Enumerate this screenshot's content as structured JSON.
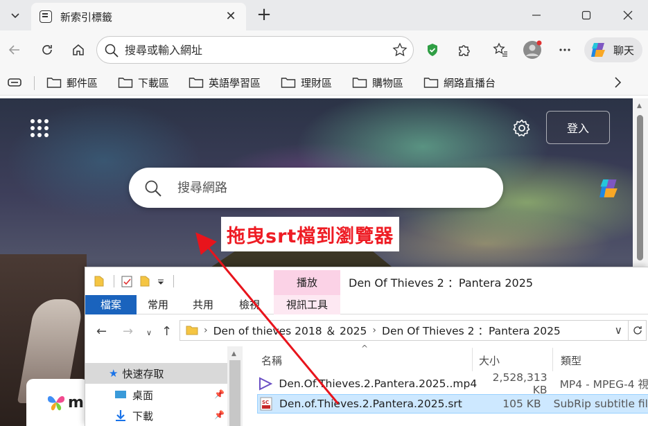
{
  "browser": {
    "tab_title": "新索引標籤",
    "address_placeholder": "搜尋或輸入網址",
    "chat_label": "聊天",
    "bookmarks": [
      "郵件區",
      "下載區",
      "英語學習區",
      "理財區",
      "購物區",
      "網路直播台"
    ]
  },
  "ntp": {
    "signin_label": "登入",
    "search_placeholder": "搜尋網路",
    "annotation": "拖曳srt檔到瀏覽器",
    "ms_card_letter": "m"
  },
  "explorer": {
    "context_tab": "播放",
    "title": "Den Of Thieves 2 ：Pantera 2025",
    "ribbon_tabs": [
      "檔案",
      "常用",
      "共用",
      "檢視",
      "視訊工具"
    ],
    "path": [
      "Den of thieves 2018 ＆ 2025",
      "Den Of Thieves 2 ：Pantera 2025"
    ],
    "nav": {
      "quick_access": "快速存取",
      "items": [
        "桌面",
        "下載"
      ]
    },
    "columns": {
      "name": "名稱",
      "size": "大小",
      "type": "類型"
    },
    "files": [
      {
        "name": "Den.Of.Thieves.2.Pantera.2025..mp4",
        "size": "2,528,313 KB",
        "type": "MP4 - MPEG-4 視",
        "icon": "video-file-icon"
      },
      {
        "name": "Den.of.Thieves.2.Pantera.2025.srt",
        "size": "105 KB",
        "type": "SubRip subtitle fil",
        "icon": "srt-file-icon"
      }
    ]
  },
  "colors": {
    "annotation_text": "#ee1c24",
    "ribbon_active": "#1a63bd",
    "context_tab": "#fbd2e6",
    "selection": "#cde8ff",
    "arrow": "#e8141c"
  }
}
